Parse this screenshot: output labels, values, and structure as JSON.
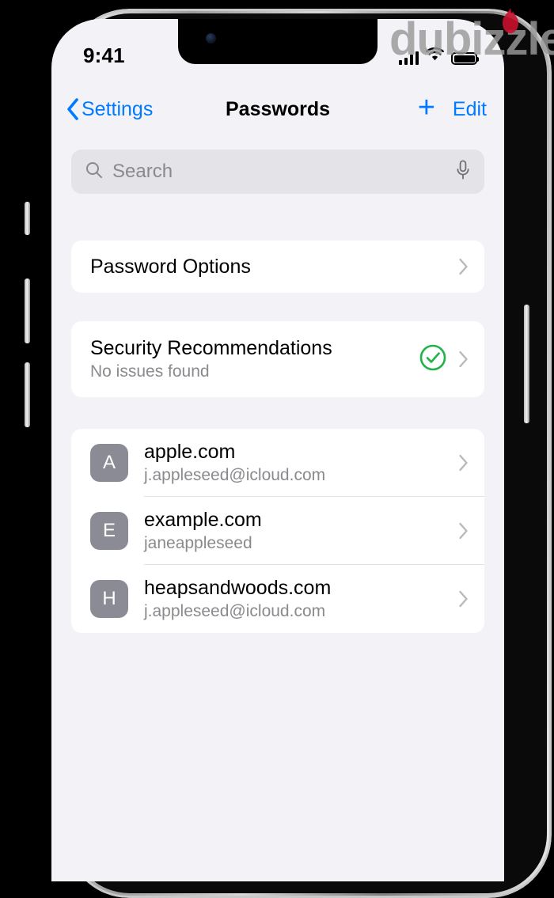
{
  "watermark": {
    "text": "dubizzle",
    "color": "#9a9a9a",
    "flame_color": "#c8102e"
  },
  "status_bar": {
    "time": "9:41",
    "signal_icon": "cellular-signal-icon",
    "wifi_icon": "wifi-icon",
    "battery_icon": "battery-icon",
    "battery_level": 100
  },
  "nav_bar": {
    "back_label": "Settings",
    "back_icon": "chevron-left-icon",
    "title": "Passwords",
    "add_label": "+",
    "edit_label": "Edit"
  },
  "search": {
    "placeholder": "Search",
    "value": "",
    "search_icon": "search-icon",
    "mic_icon": "microphone-icon"
  },
  "password_options": {
    "label": "Password Options",
    "chevron_icon": "chevron-right-icon"
  },
  "security_recommendations": {
    "title": "Security Recommendations",
    "subtitle": "No issues found",
    "badge_icon": "check-circle-icon",
    "badge_color": "#21b34a",
    "chevron_icon": "chevron-right-icon"
  },
  "accounts": {
    "items": [
      {
        "initial": "A",
        "site": "apple.com",
        "username": "j.appleseed@icloud.com",
        "chevron_icon": "chevron-right-icon"
      },
      {
        "initial": "E",
        "site": "example.com",
        "username": "janeappleseed",
        "chevron_icon": "chevron-right-icon"
      },
      {
        "initial": "H",
        "site": "heapsandwoods.com",
        "username": "j.appleseed@icloud.com",
        "chevron_icon": "chevron-right-icon"
      }
    ]
  },
  "theme": {
    "accent": "#007aff",
    "background": "#f2f2f7",
    "card": "#ffffff",
    "secondary_text": "#8a8a8e",
    "avatar": "#8b8b96"
  }
}
